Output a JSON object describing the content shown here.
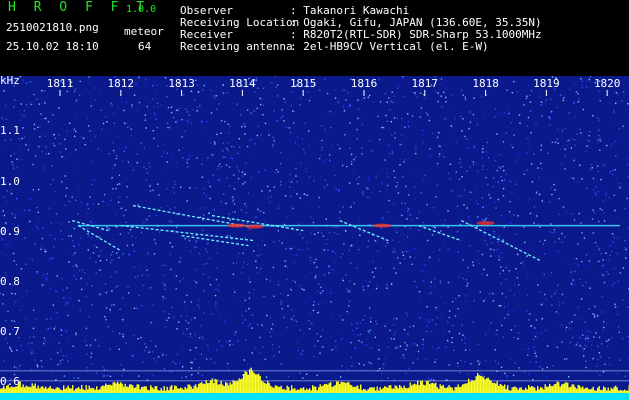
{
  "header": {
    "app_title": "H R O F F T",
    "app_version": "1.0.0",
    "filename": "2510021810.png",
    "label_kind": "meteor",
    "datetime": "25.10.02 18:10",
    "count": "64",
    "info": [
      {
        "label": "Observer",
        "value": ": Takanori Kawachi"
      },
      {
        "label": "Receiving Location",
        "value": ": Ogaki, Gifu, JAPAN (136.60E, 35.35N)"
      },
      {
        "label": "Receiver",
        "value": ": R820T2(RTL-SDR) SDR-Sharp 53.1000MHz"
      },
      {
        "label": "Receiving antenna",
        "value": ": 2el-HB9CV Vertical (el. E-W)"
      }
    ]
  },
  "chart_data": {
    "type": "heatmap",
    "y_unit_label": "kHz",
    "x_ticks": [
      "1811",
      "1812",
      "1813",
      "1814",
      "1815",
      "1816",
      "1817",
      "1818",
      "1819",
      "1820"
    ],
    "y_ticks": [
      "1.1",
      "1.0",
      "0.9",
      "0.8",
      "0.7",
      "0.6"
    ],
    "x_range": [
      1810.6,
      1820.2
    ],
    "y_range": [
      0.58,
      1.15
    ],
    "colors": {
      "background": "#0a1a8c",
      "carrier": "#40e0ff",
      "hot": "#ff3020",
      "bars": "#ffff20",
      "base": "#00e0ff"
    }
  }
}
